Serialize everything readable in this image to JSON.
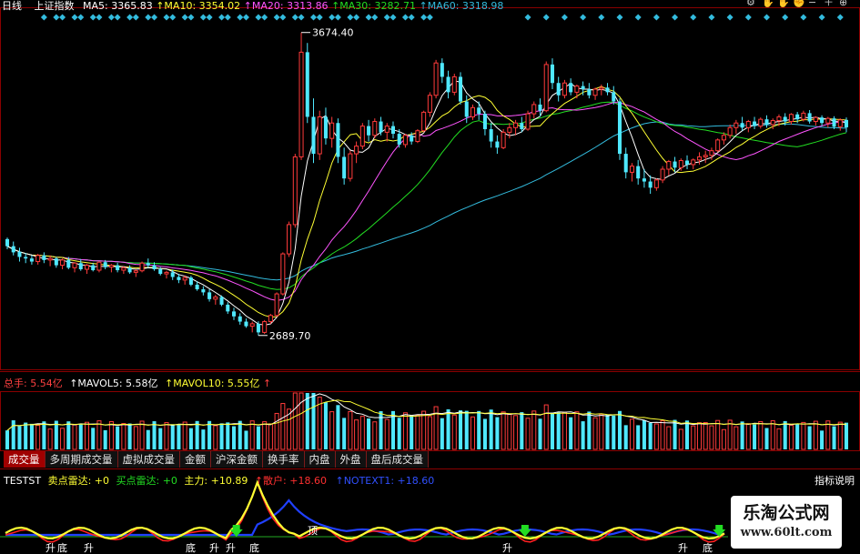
{
  "colors": {
    "up": "#ff3b3b",
    "down": "#4fe8ff",
    "ma5": "#ffffff",
    "ma10": "#ffff33",
    "ma20": "#ff55ff",
    "ma30": "#22dd22",
    "ma60": "#33bbdd",
    "frame": "#8a0000"
  },
  "header": {
    "period": "日线",
    "index_name": "上证指数",
    "ma5": "MA5: 3365.83",
    "ma10": "↑MA10: 3354.02",
    "ma20": "↑MA20: 3313.86",
    "ma30": "↑MA30: 3282.71",
    "ma60": "↑MA60: 3318.98",
    "icons": [
      "settings-icon",
      "hand-icon",
      "hand-icon",
      "fist-icon",
      "minus-icon",
      "plus-icon",
      "zoom-icon"
    ]
  },
  "price": {
    "high_label": "3674.40",
    "low_label": "2689.70"
  },
  "volume_header": {
    "total": "总手: 5.54亿",
    "mavol5": "↑MAVOL5: 5.58亿",
    "mavol10": "↑MAVOL10: 5.55亿",
    "arrow": "↑"
  },
  "tabs": [
    "成交量",
    "多周期成交量",
    "虚拟成交量",
    "金额",
    "沪深金额",
    "换手率",
    "内盘",
    "外盘",
    "盘后成交量"
  ],
  "indicator_header": {
    "name": "TESTST",
    "sell": "卖点雷达: +0",
    "buy": "买点雷达: +0",
    "main": "主力: +10.89",
    "retail": "↑散户: +18.60",
    "notext": "↑NOTEXT1: +18.60",
    "help": "指标说明"
  },
  "signal_labels": [
    "升",
    "底",
    "升",
    "底",
    "升",
    "升",
    "底",
    "顶",
    "升",
    "升",
    "底"
  ],
  "watermark": {
    "title": "乐淘公式网",
    "url": "www.60lt.com"
  },
  "chart_data": {
    "type": "candlestick",
    "ylim": [
      2580,
      3750
    ],
    "candles": [
      [
        3003,
        3008,
        2970,
        2980
      ],
      [
        2980,
        2995,
        2950,
        2960
      ],
      [
        2962,
        2975,
        2930,
        2945
      ],
      [
        2945,
        2958,
        2925,
        2940
      ],
      [
        2940,
        2950,
        2920,
        2930
      ],
      [
        2930,
        2955,
        2920,
        2950
      ],
      [
        2950,
        2960,
        2925,
        2935
      ],
      [
        2935,
        2950,
        2915,
        2940
      ],
      [
        2940,
        2945,
        2910,
        2918
      ],
      [
        2918,
        2940,
        2905,
        2935
      ],
      [
        2935,
        2945,
        2905,
        2910
      ],
      [
        2910,
        2928,
        2895,
        2925
      ],
      [
        2925,
        2938,
        2900,
        2905
      ],
      [
        2905,
        2922,
        2890,
        2918
      ],
      [
        2918,
        2926,
        2898,
        2902
      ],
      [
        2902,
        2930,
        2895,
        2928
      ],
      [
        2928,
        2935,
        2905,
        2912
      ],
      [
        2912,
        2922,
        2895,
        2918
      ],
      [
        2918,
        2926,
        2895,
        2902
      ],
      [
        2902,
        2915,
        2890,
        2910
      ],
      [
        2910,
        2918,
        2890,
        2895
      ],
      [
        2895,
        2905,
        2880,
        2900
      ],
      [
        2900,
        2930,
        2895,
        2925
      ],
      [
        2925,
        2940,
        2910,
        2918
      ],
      [
        2918,
        2928,
        2900,
        2905
      ],
      [
        2905,
        2912,
        2885,
        2890
      ],
      [
        2890,
        2900,
        2875,
        2895
      ],
      [
        2895,
        2904,
        2870,
        2880
      ],
      [
        2880,
        2890,
        2860,
        2870
      ],
      [
        2870,
        2885,
        2855,
        2878
      ],
      [
        2878,
        2884,
        2850,
        2855
      ],
      [
        2855,
        2866,
        2835,
        2840
      ],
      [
        2840,
        2850,
        2820,
        2830
      ],
      [
        2830,
        2840,
        2800,
        2808
      ],
      [
        2808,
        2822,
        2790,
        2815
      ],
      [
        2815,
        2820,
        2785,
        2790
      ],
      [
        2790,
        2798,
        2760,
        2768
      ],
      [
        2768,
        2780,
        2740,
        2752
      ],
      [
        2752,
        2762,
        2725,
        2735
      ],
      [
        2735,
        2745,
        2715,
        2720
      ],
      [
        2720,
        2735,
        2700,
        2728
      ],
      [
        2728,
        2736,
        2690,
        2700
      ],
      [
        2700,
        2740,
        2695,
        2735
      ],
      [
        2735,
        2760,
        2728,
        2755
      ],
      [
        2755,
        2830,
        2750,
        2825
      ],
      [
        2825,
        2960,
        2820,
        2955
      ],
      [
        2955,
        3060,
        2945,
        3050
      ],
      [
        3050,
        3280,
        3040,
        3270
      ],
      [
        3270,
        3674,
        3260,
        3610
      ],
      [
        3610,
        3640,
        3380,
        3400
      ],
      [
        3400,
        3460,
        3250,
        3280
      ],
      [
        3280,
        3420,
        3260,
        3400
      ],
      [
        3400,
        3430,
        3310,
        3330
      ],
      [
        3330,
        3400,
        3300,
        3380
      ],
      [
        3380,
        3395,
        3250,
        3270
      ],
      [
        3270,
        3300,
        3180,
        3200
      ],
      [
        3200,
        3290,
        3190,
        3280
      ],
      [
        3280,
        3320,
        3250,
        3305
      ],
      [
        3305,
        3380,
        3295,
        3370
      ],
      [
        3370,
        3390,
        3320,
        3340
      ],
      [
        3340,
        3395,
        3330,
        3385
      ],
      [
        3385,
        3400,
        3340,
        3350
      ],
      [
        3350,
        3380,
        3320,
        3370
      ],
      [
        3370,
        3385,
        3330,
        3345
      ],
      [
        3345,
        3360,
        3300,
        3310
      ],
      [
        3310,
        3345,
        3300,
        3340
      ],
      [
        3340,
        3350,
        3310,
        3320
      ],
      [
        3320,
        3360,
        3315,
        3355
      ],
      [
        3355,
        3420,
        3350,
        3415
      ],
      [
        3415,
        3480,
        3400,
        3470
      ],
      [
        3470,
        3585,
        3460,
        3575
      ],
      [
        3575,
        3590,
        3510,
        3530
      ],
      [
        3530,
        3550,
        3460,
        3480
      ],
      [
        3480,
        3540,
        3470,
        3530
      ],
      [
        3530,
        3545,
        3440,
        3450
      ],
      [
        3450,
        3470,
        3380,
        3400
      ],
      [
        3400,
        3440,
        3390,
        3430
      ],
      [
        3430,
        3450,
        3390,
        3410
      ],
      [
        3410,
        3420,
        3340,
        3360
      ],
      [
        3360,
        3380,
        3300,
        3320
      ],
      [
        3320,
        3340,
        3280,
        3300
      ],
      [
        3300,
        3360,
        3295,
        3350
      ],
      [
        3350,
        3380,
        3330,
        3365
      ],
      [
        3365,
        3390,
        3340,
        3380
      ],
      [
        3380,
        3400,
        3350,
        3360
      ],
      [
        3360,
        3420,
        3355,
        3410
      ],
      [
        3410,
        3450,
        3395,
        3440
      ],
      [
        3440,
        3460,
        3400,
        3420
      ],
      [
        3420,
        3580,
        3415,
        3570
      ],
      [
        3570,
        3590,
        3490,
        3510
      ],
      [
        3510,
        3530,
        3450,
        3470
      ],
      [
        3470,
        3520,
        3460,
        3510
      ],
      [
        3510,
        3525,
        3470,
        3480
      ],
      [
        3480,
        3505,
        3460,
        3500
      ],
      [
        3500,
        3515,
        3470,
        3490
      ],
      [
        3490,
        3510,
        3460,
        3470
      ],
      [
        3470,
        3495,
        3455,
        3490
      ],
      [
        3490,
        3505,
        3470,
        3495
      ],
      [
        3495,
        3510,
        3470,
        3480
      ],
      [
        3480,
        3500,
        3440,
        3450
      ],
      [
        3450,
        3460,
        3260,
        3280
      ],
      [
        3280,
        3300,
        3200,
        3220
      ],
      [
        3220,
        3250,
        3190,
        3240
      ],
      [
        3240,
        3260,
        3180,
        3200
      ],
      [
        3200,
        3230,
        3170,
        3190
      ],
      [
        3190,
        3210,
        3150,
        3170
      ],
      [
        3170,
        3200,
        3160,
        3195
      ],
      [
        3195,
        3240,
        3185,
        3230
      ],
      [
        3230,
        3260,
        3210,
        3255
      ],
      [
        3255,
        3270,
        3220,
        3235
      ],
      [
        3235,
        3265,
        3225,
        3258
      ],
      [
        3258,
        3275,
        3230,
        3245
      ],
      [
        3245,
        3265,
        3230,
        3260
      ],
      [
        3260,
        3285,
        3245,
        3270
      ],
      [
        3270,
        3290,
        3250,
        3275
      ],
      [
        3275,
        3300,
        3260,
        3290
      ],
      [
        3290,
        3330,
        3285,
        3325
      ],
      [
        3325,
        3350,
        3310,
        3340
      ],
      [
        3340,
        3375,
        3330,
        3365
      ],
      [
        3365,
        3390,
        3345,
        3380
      ],
      [
        3380,
        3400,
        3355,
        3365
      ],
      [
        3365,
        3390,
        3350,
        3385
      ],
      [
        3385,
        3400,
        3360,
        3370
      ],
      [
        3370,
        3398,
        3362,
        3392
      ],
      [
        3392,
        3405,
        3365,
        3375
      ],
      [
        3375,
        3395,
        3360,
        3388
      ],
      [
        3388,
        3408,
        3370,
        3400
      ],
      [
        3400,
        3412,
        3372,
        3385
      ],
      [
        3385,
        3412,
        3375,
        3408
      ],
      [
        3408,
        3416,
        3380,
        3392
      ],
      [
        3392,
        3420,
        3385,
        3412
      ],
      [
        3412,
        3422,
        3378,
        3385
      ],
      [
        3385,
        3402,
        3372,
        3398
      ],
      [
        3398,
        3405,
        3370,
        3380
      ],
      [
        3380,
        3400,
        3365,
        3395
      ],
      [
        3395,
        3402,
        3360,
        3368
      ],
      [
        3368,
        3395,
        3355,
        3390
      ],
      [
        3390,
        3398,
        3350,
        3366
      ]
    ]
  }
}
